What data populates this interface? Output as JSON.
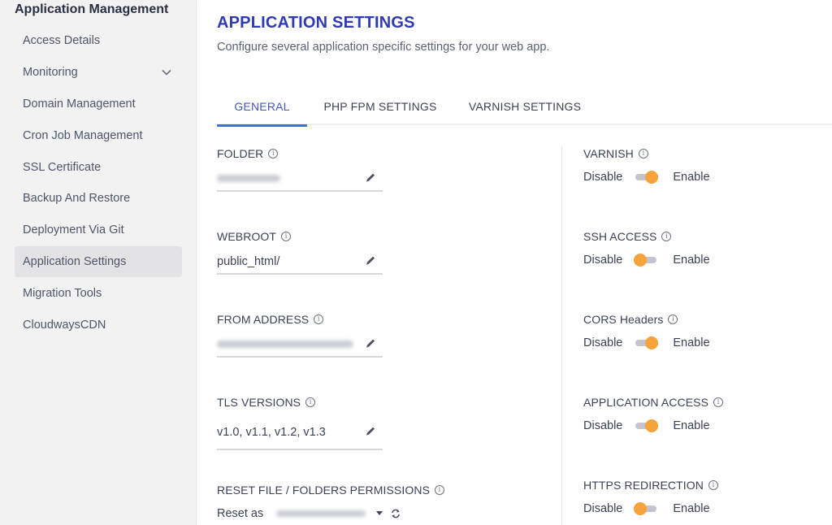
{
  "sidebar": {
    "title": "Application Management",
    "items": [
      {
        "label": "Access Details"
      },
      {
        "label": "Monitoring",
        "has_chevron": true
      },
      {
        "label": "Domain Management"
      },
      {
        "label": "Cron Job Management"
      },
      {
        "label": "SSL Certificate"
      },
      {
        "label": "Backup And Restore"
      },
      {
        "label": "Deployment Via Git"
      },
      {
        "label": "Application Settings",
        "active": true
      },
      {
        "label": "Migration Tools"
      },
      {
        "label": "CloudwaysCDN"
      }
    ]
  },
  "header": {
    "title": "APPLICATION SETTINGS",
    "subtitle": "Configure several application specific settings for your web app."
  },
  "tabs": [
    {
      "label": "GENERAL",
      "active": true
    },
    {
      "label": "PHP FPM SETTINGS"
    },
    {
      "label": "VARNISH SETTINGS"
    }
  ],
  "fields": {
    "folder": {
      "label": "FOLDER",
      "value": "",
      "blurred": true
    },
    "webroot": {
      "label": "WEBROOT",
      "value": "public_html/"
    },
    "from_address": {
      "label": "FROM ADDRESS",
      "value": "",
      "blurred": true
    },
    "tls_versions": {
      "label": "TLS VERSIONS",
      "value": "v1.0, v1.1, v1.2, v1.3"
    },
    "reset_permissions": {
      "label": "RESET FILE / FOLDERS PERMISSIONS",
      "prefix": "Reset as",
      "value": "",
      "blurred": true
    }
  },
  "toggles": {
    "disable_label": "Disable",
    "enable_label": "Enable",
    "items": [
      {
        "label": "VARNISH",
        "enabled": true
      },
      {
        "label": "SSH ACCESS",
        "enabled": false
      },
      {
        "label": "CORS Headers",
        "enabled": true
      },
      {
        "label": "APPLICATION ACCESS",
        "enabled": true
      },
      {
        "label": "HTTPS REDIRECTION",
        "enabled": false
      }
    ]
  },
  "icons": {
    "info": "i"
  },
  "colors": {
    "accent_blue": "#2e3bb5",
    "tab_underline": "#3e6ae1",
    "toggle_knob": "#f5a33a",
    "toggle_track": "#c2c5cf",
    "sidebar_bg": "#f2f2f3",
    "sidebar_active_bg": "#e3e3e5"
  }
}
